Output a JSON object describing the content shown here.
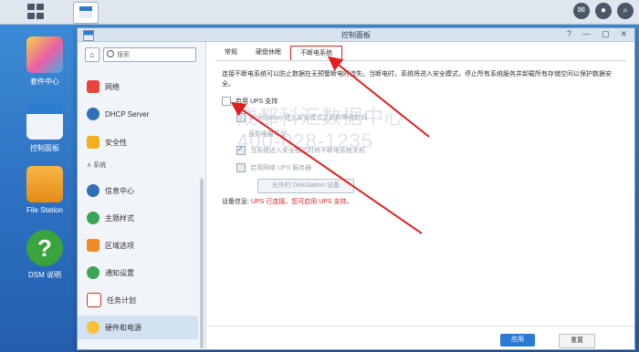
{
  "desktop": {
    "icons": [
      {
        "label": "套件中心"
      },
      {
        "label": "控制面板"
      },
      {
        "label": "File Station"
      },
      {
        "label": "DSM 说明"
      }
    ]
  },
  "window": {
    "title": "控制面板",
    "controls": [
      "?",
      "—",
      "▢",
      "✕"
    ]
  },
  "sidebar": {
    "search_placeholder": "搜索",
    "items": [
      {
        "label": "网络"
      },
      {
        "label": "DHCP Server"
      },
      {
        "label": "安全性"
      },
      {
        "group": "系统"
      },
      {
        "label": "信息中心"
      },
      {
        "label": "主题样式"
      },
      {
        "label": "区域选项"
      },
      {
        "label": "通知设置"
      },
      {
        "label": "任务计划"
      },
      {
        "label": "硬件和电源"
      }
    ]
  },
  "tabs": [
    "常规",
    "硬盘休眠",
    "不断电系统"
  ],
  "main": {
    "description": "连接不断电系统可以防止数据在无预警断电时流失。当断电时，系统将进入安全模式，停止所有系统服务并卸载所有存储空间以保护数据安全。",
    "options": [
      {
        "label": "启用 UPS 支持"
      },
      {
        "label": "DiskStation 进入安全模式之前的等待时间"
      },
      {
        "label": "直到电量不足"
      },
      {
        "label": "当系统进入安全模式时将不断电系统关机"
      },
      {
        "label": "启用网络 UPS 服务器"
      }
    ],
    "permit_button": "允许的 DiskStation 设备",
    "status_label": "设备信息:",
    "status_value": "UPS 已连接。您可启用 UPS 支持。"
  },
  "footer": {
    "apply": "应用",
    "reset": "重置"
  },
  "watermark": {
    "line1": "成都科汇数据中心",
    "line2": "400-028-1235"
  }
}
